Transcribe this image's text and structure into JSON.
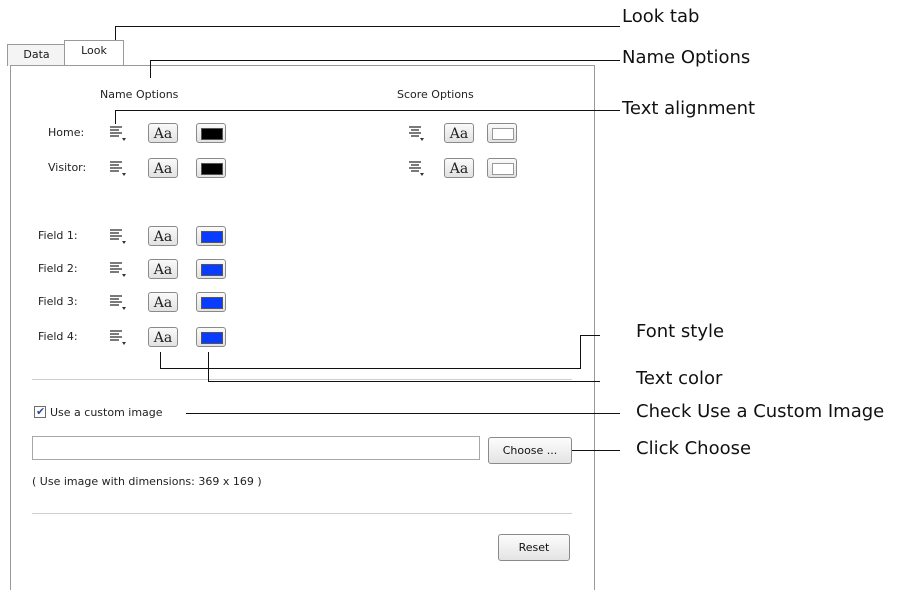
{
  "tabs": [
    {
      "label": "Data"
    },
    {
      "label": "Look"
    }
  ],
  "headers": {
    "name_options": "Name Options",
    "score_options": "Score Options"
  },
  "rows": [
    {
      "label": "Home:",
      "name_color": "#000000",
      "score_color": "#ffffff"
    },
    {
      "label": "Visitor:",
      "name_color": "#000000",
      "score_color": "#ffffff"
    },
    {
      "label": "Field 1:",
      "name_color": "#0a3cff"
    },
    {
      "label": "Field 2:",
      "name_color": "#0a3cff"
    },
    {
      "label": "Field 3:",
      "name_color": "#0a3cff"
    },
    {
      "label": "Field 4:",
      "name_color": "#0a3cff"
    }
  ],
  "font_button_label": "Aa",
  "custom_image": {
    "checked": true,
    "label": "Use a custom image",
    "path_value": "",
    "choose_label": "Choose ...",
    "hint": "( Use image with dimensions: 369 x 169 )"
  },
  "reset_label": "Reset",
  "callouts": {
    "look_tab": "Look tab",
    "name_options": "Name Options",
    "text_alignment": "Text alignment",
    "font_style": "Font style",
    "text_color": "Text color",
    "check_custom_image": "Check Use a Custom Image",
    "click_choose": "Click Choose"
  },
  "icons": {
    "align": "align-left-icon",
    "align_center": "align-center-icon"
  }
}
